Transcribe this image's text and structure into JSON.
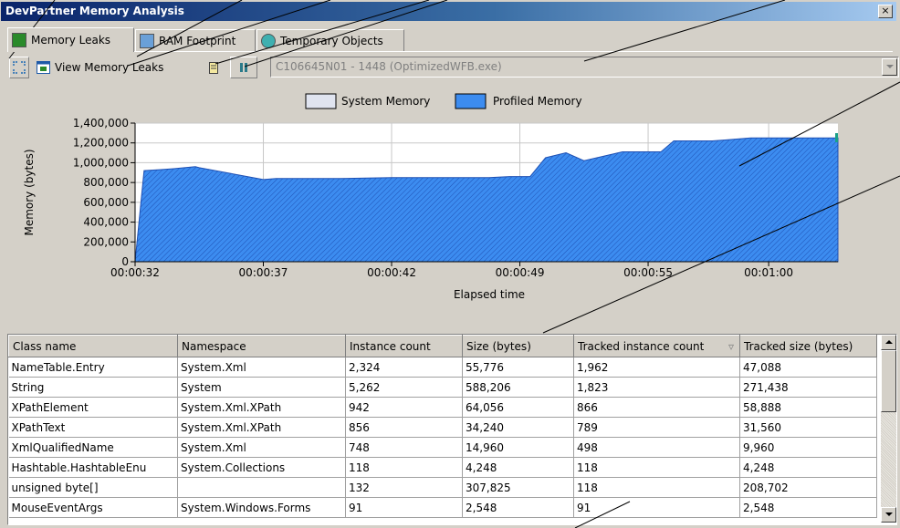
{
  "window": {
    "title": "DevPartner Memory Analysis",
    "close_label": "×"
  },
  "tabs": [
    {
      "label": "Memory Leaks",
      "icon": "memory-leaks-icon",
      "active": true
    },
    {
      "label": "RAM Footprint",
      "icon": "ram-footprint-icon",
      "active": false
    },
    {
      "label": "Temporary Objects",
      "icon": "temporary-objects-icon",
      "active": false
    }
  ],
  "toolbar": {
    "view_label": "View Memory Leaks",
    "process_value": "C106645N01 - 1448 (OptimizedWFB.exe)"
  },
  "legend": {
    "system_memory": "System Memory",
    "profiled_memory": "Profiled Memory"
  },
  "chart_data": {
    "type": "area",
    "title": "",
    "xlabel": "Elapsed time",
    "ylabel": "Memory (bytes)",
    "ylim": [
      0,
      1400000
    ],
    "yticks": [
      "0",
      "200,000",
      "400,000",
      "600,000",
      "800,000",
      "1,000,000",
      "1,200,000",
      "1,400,000"
    ],
    "xticks": [
      "00:00:32",
      "00:00:37",
      "00:00:42",
      "00:00:49",
      "00:00:55",
      "00:01:00"
    ],
    "grid": true,
    "legend_position": "top-center",
    "colors": {
      "profiled": "#3c8cf0",
      "system": "#e0e4f0"
    },
    "series": [
      {
        "name": "Profiled Memory",
        "x": [
          0,
          0.35,
          1.0,
          1.5,
          2.35,
          2.5,
          5.0,
          5.5,
          8.0,
          10.0,
          10.3,
          13.8,
          14.6,
          15.4,
          16.0,
          16.8,
          17.5,
          18.0,
          19.0,
          20.5,
          21.0,
          22.5,
          23.0,
          24.0,
          25.0,
          25.5,
          27.4
        ],
        "y": [
          0,
          920000,
          930000,
          940000,
          960000,
          950000,
          830000,
          840000,
          840000,
          850000,
          850000,
          850000,
          860000,
          860000,
          1050000,
          1100000,
          1020000,
          1050000,
          1110000,
          1110000,
          1220000,
          1220000,
          1230000,
          1250000,
          1250000,
          1250000,
          1250000
        ]
      },
      {
        "name": "System Memory",
        "x": [],
        "y": []
      }
    ]
  },
  "table": {
    "columns": [
      "Class name",
      "Namespace",
      "Instance count",
      "Size (bytes)",
      "Tracked instance count",
      "Tracked size (bytes)"
    ],
    "sort_indicator": "▿",
    "rows": [
      [
        "NameTable.Entry",
        "System.Xml",
        "2,324",
        "55,776",
        "1,962",
        "47,088"
      ],
      [
        "String",
        "System",
        "5,262",
        "588,206",
        "1,823",
        "271,438"
      ],
      [
        "XPathElement",
        "System.Xml.XPath",
        "942",
        "64,056",
        "866",
        "58,888"
      ],
      [
        "XPathText",
        "System.Xml.XPath",
        "856",
        "34,240",
        "789",
        "31,560"
      ],
      [
        "XmlQualifiedName",
        "System.Xml",
        "748",
        "14,960",
        "498",
        "9,960"
      ],
      [
        "Hashtable.HashtableEnu",
        "System.Collections",
        "118",
        "4,248",
        "118",
        "4,248"
      ],
      [
        "unsigned byte[]",
        "",
        "132",
        "307,825",
        "118",
        "208,702"
      ],
      [
        "MouseEventArgs",
        "System.Windows.Forms",
        "91",
        "2,548",
        "91",
        "2,548"
      ]
    ]
  }
}
